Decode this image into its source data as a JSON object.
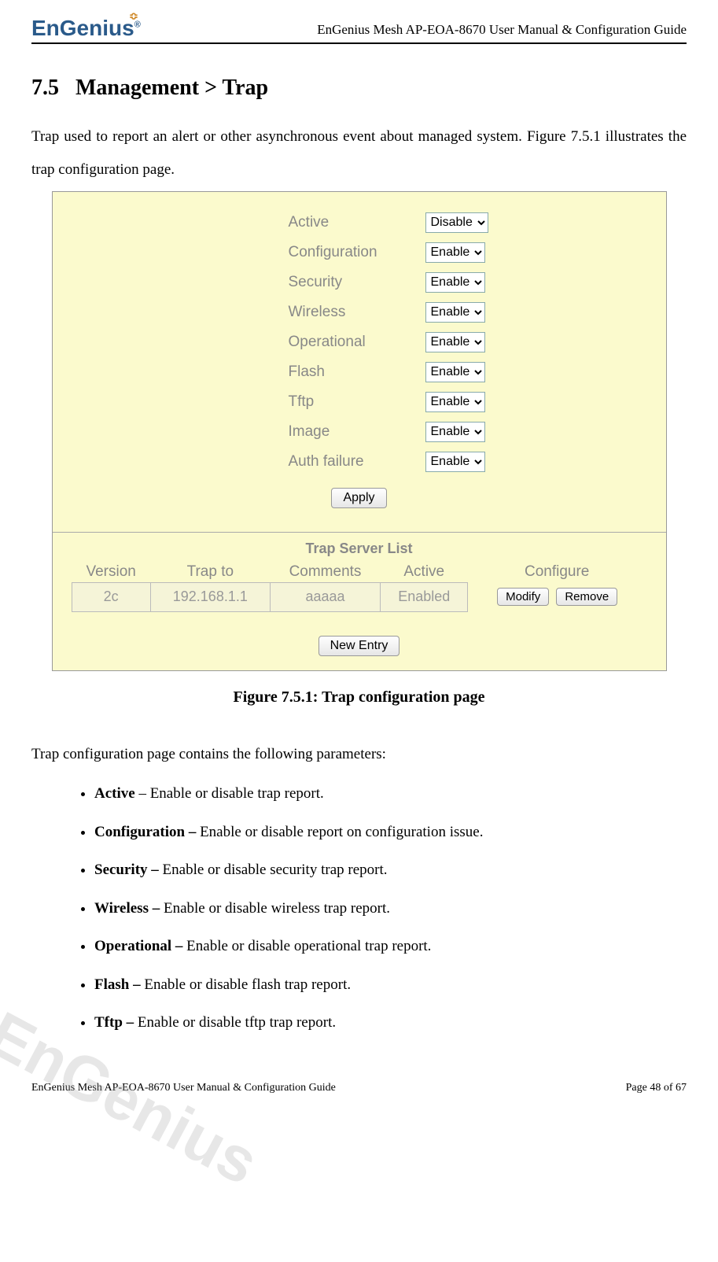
{
  "header": {
    "logo_text": "EnGenius",
    "doc_title": "EnGenius Mesh AP-EOA-8670 User Manual & Configuration Guide"
  },
  "section": {
    "number": "7.5",
    "title": "Management > Trap"
  },
  "intro": "Trap used to report an alert or other asynchronous event about managed system. Figure 7.5.1 illustrates the trap configuration page.",
  "trap_config": {
    "rows": [
      {
        "label": "Active",
        "value": "Disable"
      },
      {
        "label": "Configuration",
        "value": "Enable"
      },
      {
        "label": "Security",
        "value": "Enable"
      },
      {
        "label": "Wireless",
        "value": "Enable"
      },
      {
        "label": "Operational",
        "value": "Enable"
      },
      {
        "label": "Flash",
        "value": "Enable"
      },
      {
        "label": "Tftp",
        "value": "Enable"
      },
      {
        "label": "Image",
        "value": "Enable"
      },
      {
        "label": "Auth failure",
        "value": "Enable"
      }
    ],
    "apply_label": "Apply"
  },
  "server_list": {
    "title": "Trap Server List",
    "headers": [
      "Version",
      "Trap to",
      "Comments",
      "Active",
      "Configure"
    ],
    "row": {
      "version": "2c",
      "trap_to": "192.168.1.1",
      "comments": "aaaaa",
      "active": "Enabled",
      "modify_label": "Modify",
      "remove_label": "Remove"
    },
    "new_entry_label": "New Entry"
  },
  "caption": "Figure 7.5.1: Trap configuration page",
  "params_intro": "Trap configuration page contains the following parameters:",
  "params": [
    {
      "term": "Active",
      "sep": " – ",
      "desc": "Enable or disable trap report."
    },
    {
      "term": "Configuration –",
      "sep": " ",
      "desc": "Enable or disable report on configuration issue."
    },
    {
      "term": "Security –",
      "sep": " ",
      "desc": "Enable or disable security trap report."
    },
    {
      "term": "Wireless –",
      "sep": " ",
      "desc": "Enable or disable wireless trap report."
    },
    {
      "term": "Operational –",
      "sep": " ",
      "desc": "Enable or disable operational trap report."
    },
    {
      "term": "Flash –",
      "sep": " ",
      "desc": "Enable or disable flash trap report."
    },
    {
      "term": "Tftp –",
      "sep": " ",
      "desc": "Enable or disable tftp trap report."
    }
  ],
  "footer": {
    "left": "EnGenius Mesh AP-EOA-8670 User Manual & Configuration Guide",
    "right": "Page 48 of 67"
  },
  "watermark": "EnGenius"
}
